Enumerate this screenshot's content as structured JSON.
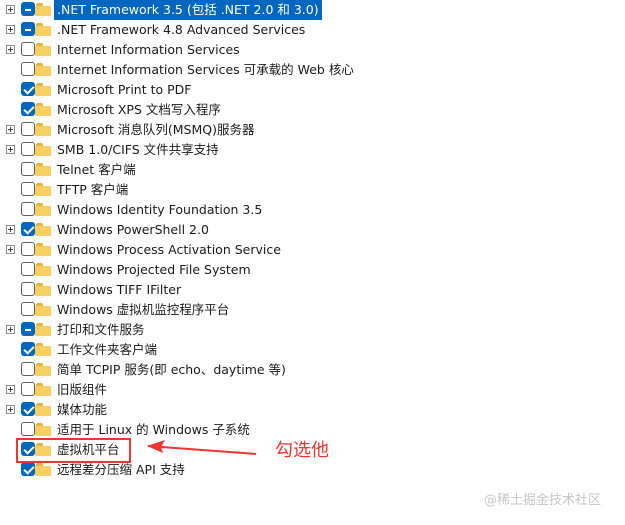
{
  "features": {
    "items": [
      {
        "label": ".NET Framework 3.5 (包括 .NET 2.0 和 3.0)",
        "state": "partial",
        "expandable": true,
        "highlighted": true
      },
      {
        "label": ".NET Framework 4.8 Advanced Services",
        "state": "partial",
        "expandable": true,
        "highlighted": false
      },
      {
        "label": "Internet Information Services",
        "state": "unchecked",
        "expandable": true,
        "highlighted": false
      },
      {
        "label": "Internet Information Services 可承载的 Web 核心",
        "state": "unchecked",
        "expandable": false,
        "highlighted": false
      },
      {
        "label": "Microsoft Print to PDF",
        "state": "checked",
        "expandable": false,
        "highlighted": false
      },
      {
        "label": "Microsoft XPS 文档写入程序",
        "state": "checked",
        "expandable": false,
        "highlighted": false
      },
      {
        "label": "Microsoft 消息队列(MSMQ)服务器",
        "state": "unchecked",
        "expandable": true,
        "highlighted": false
      },
      {
        "label": "SMB 1.0/CIFS 文件共享支持",
        "state": "unchecked",
        "expandable": true,
        "highlighted": false
      },
      {
        "label": "Telnet 客户端",
        "state": "unchecked",
        "expandable": false,
        "highlighted": false
      },
      {
        "label": "TFTP 客户端",
        "state": "unchecked",
        "expandable": false,
        "highlighted": false
      },
      {
        "label": "Windows Identity Foundation 3.5",
        "state": "unchecked",
        "expandable": false,
        "highlighted": false
      },
      {
        "label": "Windows PowerShell 2.0",
        "state": "checked",
        "expandable": true,
        "highlighted": false
      },
      {
        "label": "Windows Process Activation Service",
        "state": "unchecked",
        "expandable": true,
        "highlighted": false
      },
      {
        "label": "Windows Projected File System",
        "state": "unchecked",
        "expandable": false,
        "highlighted": false
      },
      {
        "label": "Windows TIFF IFilter",
        "state": "unchecked",
        "expandable": false,
        "highlighted": false
      },
      {
        "label": "Windows 虚拟机监控程序平台",
        "state": "unchecked",
        "expandable": false,
        "highlighted": false
      },
      {
        "label": "打印和文件服务",
        "state": "partial",
        "expandable": true,
        "highlighted": false
      },
      {
        "label": "工作文件夹客户端",
        "state": "checked",
        "expandable": false,
        "highlighted": false
      },
      {
        "label": "简单 TCPIP 服务(即 echo、daytime 等)",
        "state": "unchecked",
        "expandable": false,
        "highlighted": false
      },
      {
        "label": "旧版组件",
        "state": "unchecked",
        "expandable": true,
        "highlighted": false
      },
      {
        "label": "媒体功能",
        "state": "checked",
        "expandable": true,
        "highlighted": false
      },
      {
        "label": "适用于 Linux 的 Windows 子系统",
        "state": "unchecked",
        "expandable": false,
        "highlighted": false
      },
      {
        "label": "虚拟机平台",
        "state": "checked",
        "expandable": false,
        "highlighted": false
      },
      {
        "label": "远程差分压缩 API 支持",
        "state": "checked",
        "expandable": false,
        "highlighted": false
      }
    ]
  },
  "annotation": {
    "text": "勾选他",
    "color": "#ef3434"
  },
  "watermark": {
    "text": "@稀土掘金技术社区"
  },
  "colors": {
    "accent": "#0067c0",
    "folder": "#f7cf63",
    "annotation": "#ef3434"
  },
  "icons": {
    "expand": "plus-square-icon",
    "checkbox": "checkbox-icon",
    "folder": "folder-icon",
    "arrow": "left-arrow-icon"
  }
}
